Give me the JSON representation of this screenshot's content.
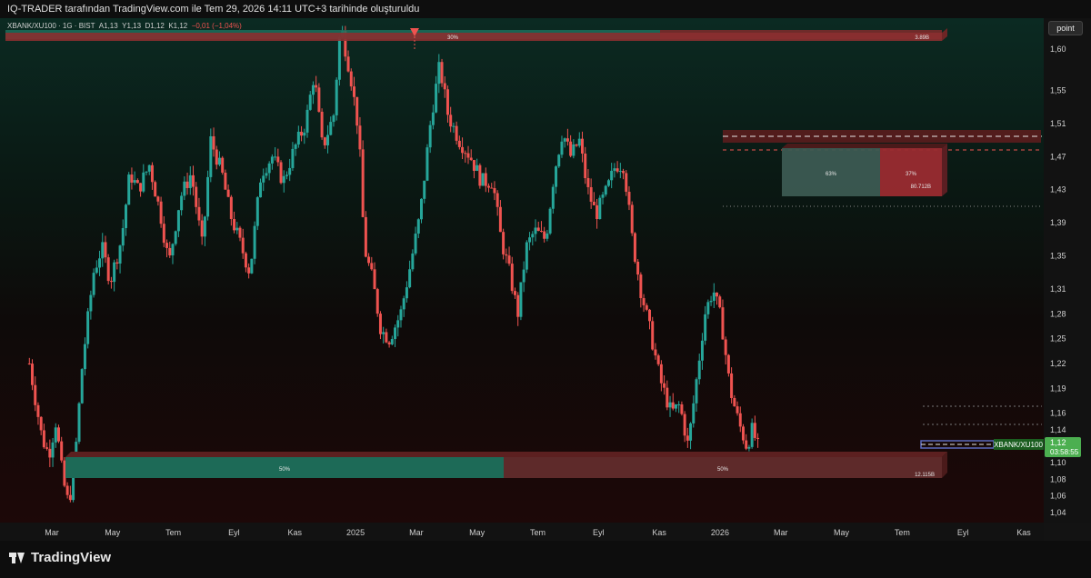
{
  "header": {
    "caption": "IQ-TRADER tarafından TradingView.com ile Tem 29, 2026 14:11 UTC+3 tarihinde oluşturuldu"
  },
  "symbol_info": {
    "name": "XBANK/XU100 · 1G · BIST",
    "open": "A1,13",
    "high": "Y1,13",
    "low": "D1,12",
    "close": "K1,12",
    "change": "−0,01 (−1,04%)"
  },
  "toolbar": {
    "point_label": "point"
  },
  "footer": {
    "logo_text": "TradingView"
  },
  "colors": {
    "up": "#26a69a",
    "down": "#ef5350",
    "green_zone": "#1e6e5c",
    "red_zone": "#5a2a2a",
    "last_price": "#4caf50"
  },
  "chart_data": {
    "type": "candlestick",
    "symbol": "XBANK/XU100",
    "interval": "1G",
    "exchange": "BIST",
    "ylim": [
      1.03,
      1.635
    ],
    "price_ticks": [
      "1,60",
      "1,55",
      "1,51",
      "1,47",
      "1,43",
      "1,39",
      "1,35",
      "1,31",
      "1,28",
      "1,25",
      "1,22",
      "1,19",
      "1,16",
      "1,14",
      "1,10",
      "1,08",
      "1,06",
      "1,04"
    ],
    "time_ticks": [
      "Mar",
      "May",
      "Tem",
      "Eyl",
      "Kas",
      "2025",
      "Mar",
      "May",
      "Tem",
      "Eyl",
      "Kas",
      "2026",
      "Mar",
      "May",
      "Tem",
      "Eyl",
      "Kas"
    ],
    "price_path": [
      {
        "t": 0.0,
        "p": 1.22
      },
      {
        "t": 0.45,
        "p": 1.13
      },
      {
        "t": 0.7,
        "p": 1.11
      },
      {
        "t": 0.95,
        "p": 1.15
      },
      {
        "t": 1.2,
        "p": 1.08
      },
      {
        "t": 1.4,
        "p": 1.05
      },
      {
        "t": 1.6,
        "p": 1.09
      },
      {
        "t": 1.9,
        "p": 1.22
      },
      {
        "t": 2.3,
        "p": 1.33
      },
      {
        "t": 2.6,
        "p": 1.36
      },
      {
        "t": 2.9,
        "p": 1.32
      },
      {
        "t": 3.3,
        "p": 1.37
      },
      {
        "t": 3.6,
        "p": 1.45
      },
      {
        "t": 3.9,
        "p": 1.43
      },
      {
        "t": 4.3,
        "p": 1.46
      },
      {
        "t": 4.7,
        "p": 1.4
      },
      {
        "t": 5.0,
        "p": 1.34
      },
      {
        "t": 5.4,
        "p": 1.42
      },
      {
        "t": 5.8,
        "p": 1.45
      },
      {
        "t": 6.2,
        "p": 1.36
      },
      {
        "t": 6.5,
        "p": 1.49
      },
      {
        "t": 6.9,
        "p": 1.45
      },
      {
        "t": 7.2,
        "p": 1.4
      },
      {
        "t": 7.6,
        "p": 1.36
      },
      {
        "t": 7.9,
        "p": 1.33
      },
      {
        "t": 8.3,
        "p": 1.45
      },
      {
        "t": 8.7,
        "p": 1.47
      },
      {
        "t": 9.1,
        "p": 1.44
      },
      {
        "t": 9.5,
        "p": 1.48
      },
      {
        "t": 9.9,
        "p": 1.51
      },
      {
        "t": 10.2,
        "p": 1.57
      },
      {
        "t": 10.5,
        "p": 1.48
      },
      {
        "t": 10.9,
        "p": 1.52
      },
      {
        "t": 11.15,
        "p": 1.63
      },
      {
        "t": 11.5,
        "p": 1.57
      },
      {
        "t": 11.8,
        "p": 1.5
      },
      {
        "t": 12.0,
        "p": 1.36
      },
      {
        "t": 12.3,
        "p": 1.32
      },
      {
        "t": 12.6,
        "p": 1.26
      },
      {
        "t": 12.9,
        "p": 1.25
      },
      {
        "t": 13.3,
        "p": 1.28
      },
      {
        "t": 13.6,
        "p": 1.33
      },
      {
        "t": 14.0,
        "p": 1.4
      },
      {
        "t": 14.4,
        "p": 1.52
      },
      {
        "t": 14.7,
        "p": 1.58
      },
      {
        "t": 15.0,
        "p": 1.52
      },
      {
        "t": 15.4,
        "p": 1.49
      },
      {
        "t": 15.8,
        "p": 1.47
      },
      {
        "t": 16.2,
        "p": 1.44
      },
      {
        "t": 16.6,
        "p": 1.44
      },
      {
        "t": 16.9,
        "p": 1.37
      },
      {
        "t": 17.2,
        "p": 1.33
      },
      {
        "t": 17.5,
        "p": 1.28
      },
      {
        "t": 17.8,
        "p": 1.36
      },
      {
        "t": 18.1,
        "p": 1.38
      },
      {
        "t": 18.5,
        "p": 1.37
      },
      {
        "t": 18.8,
        "p": 1.45
      },
      {
        "t": 19.1,
        "p": 1.5
      },
      {
        "t": 19.4,
        "p": 1.47
      },
      {
        "t": 19.7,
        "p": 1.49
      },
      {
        "t": 20.0,
        "p": 1.43
      },
      {
        "t": 20.3,
        "p": 1.4
      },
      {
        "t": 20.7,
        "p": 1.43
      },
      {
        "t": 21.0,
        "p": 1.46
      },
      {
        "t": 21.3,
        "p": 1.46
      },
      {
        "t": 21.6,
        "p": 1.37
      },
      {
        "t": 21.9,
        "p": 1.31
      },
      {
        "t": 22.3,
        "p": 1.25
      },
      {
        "t": 22.6,
        "p": 1.2
      },
      {
        "t": 23.0,
        "p": 1.16
      },
      {
        "t": 23.3,
        "p": 1.17
      },
      {
        "t": 23.6,
        "p": 1.12
      },
      {
        "t": 23.9,
        "p": 1.2
      },
      {
        "t": 24.2,
        "p": 1.28
      },
      {
        "t": 24.5,
        "p": 1.31
      },
      {
        "t": 24.8,
        "p": 1.27
      },
      {
        "t": 25.1,
        "p": 1.19
      },
      {
        "t": 25.4,
        "p": 1.15
      },
      {
        "t": 25.7,
        "p": 1.12
      },
      {
        "t": 25.9,
        "p": 1.14
      },
      {
        "t": 26.1,
        "p": 1.12
      }
    ],
    "annotations": {
      "top_bar": {
        "left_pct": "30%",
        "right_value": "3.89B"
      },
      "bottom_bar": {
        "left_pct": "50%",
        "right_pct": "50%",
        "right_value": "12.115B"
      },
      "mid_box": {
        "left_pct": "63%",
        "right_pct": "37%",
        "right_value": "80.712B"
      }
    },
    "last_price": {
      "symbol": "XBANK/XU100",
      "value": "1,12",
      "countdown": "03:58:55"
    }
  }
}
